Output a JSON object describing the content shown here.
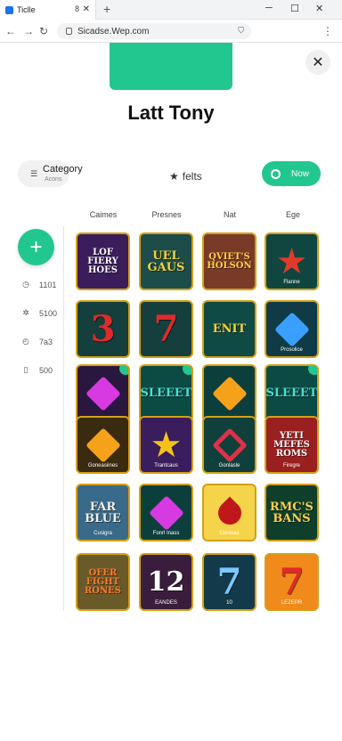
{
  "browser": {
    "tab_title": "Ticlle",
    "tab_mid": "8",
    "url": "Sicadse.Wep.com",
    "new_tab": "+"
  },
  "page": {
    "title": "Latt Tony",
    "close": "✕",
    "category": {
      "label": "Category",
      "sub": "Acons"
    },
    "star_label": "felts",
    "now_button": "Now",
    "columns": [
      "Caimes",
      "Presnes",
      "Nat",
      "Ege"
    ],
    "sidebar": [
      {
        "icon": "clock-icon",
        "label": "1101"
      },
      {
        "icon": "sparkle-icon",
        "label": "5100"
      },
      {
        "icon": "timer-icon",
        "label": "7a3"
      },
      {
        "icon": "phone-icon",
        "label": "500"
      }
    ]
  },
  "tiles": [
    {
      "text": "LOF FIERY HOES",
      "sub": "",
      "bg": "#3b1d5c",
      "fg": "#ffffff"
    },
    {
      "text": "UEL GAUS",
      "sub": "",
      "bg": "#1c4d4a",
      "fg": "#f5d13a"
    },
    {
      "text": "QVIET'S HOLSON",
      "sub": "",
      "bg": "#7a3a28",
      "fg": "#ffd04a"
    },
    {
      "text": "",
      "sub": "Flanne",
      "bg": "#10463f",
      "fg": "#e03a2a",
      "shape": "star"
    },
    {
      "text": "3",
      "sub": "",
      "bg": "#153f3c",
      "fg": "#e02a2a"
    },
    {
      "text": "7",
      "sub": "",
      "bg": "#153f3c",
      "fg": "#e02a2a"
    },
    {
      "text": "ENIT",
      "sub": "",
      "bg": "#0f4a44",
      "fg": "#f5d13a"
    },
    {
      "text": "",
      "sub": "Prosolice",
      "bg": "#103b46",
      "fg": "#3aa0ff",
      "shape": "gem"
    },
    {
      "text": "",
      "sub": "",
      "bg": "#2a1740",
      "fg": "#d63ae0",
      "shape": "gem",
      "dot": true
    },
    {
      "text": "SLEEET",
      "sub": "",
      "bg": "#0c4a44",
      "fg": "#45e0d0",
      "dot": true
    },
    {
      "text": "",
      "sub": "",
      "bg": "#0c3f3b",
      "fg": "#f5a21a",
      "shape": "gem"
    },
    {
      "text": "SLEEET",
      "sub": "",
      "bg": "#0c4a44",
      "fg": "#45e0d0",
      "dot": true
    },
    {
      "text": "",
      "sub": "Goneasiines",
      "bg": "#3a2a10",
      "fg": "#f5a21a",
      "shape": "gem"
    },
    {
      "text": "",
      "sub": "Trantcaus",
      "bg": "#3a1d5c",
      "fg": "#f5c21a",
      "shape": "star"
    },
    {
      "text": "",
      "sub": "Gonlasle",
      "bg": "#10403c",
      "fg": "#e0304a",
      "shape": "diamond"
    },
    {
      "text": "YETI MEFES ROMS",
      "sub": "Firegre",
      "bg": "#9a1f1f",
      "fg": "#ffffff"
    },
    {
      "text": "FAR BLUE",
      "sub": "Cusigra",
      "bg": "#3a6a8a",
      "fg": "#f0f0f0"
    },
    {
      "text": "",
      "sub": "Fonrl Inass",
      "bg": "#0c3f3b",
      "fg": "#d63ae0",
      "shape": "gem"
    },
    {
      "text": "",
      "sub": "Conloas",
      "bg": "#f5d34a",
      "fg": "#c0181a",
      "shape": "drop"
    },
    {
      "text": "RMC'S BANS",
      "sub": "",
      "bg": "#0f3f2a",
      "fg": "#ffd04a"
    },
    {
      "text": "OFER FIGHT RONES",
      "sub": "",
      "bg": "#6a5a2a",
      "fg": "#ff7a2a"
    },
    {
      "text": "12",
      "sub": "EANDES",
      "bg": "#3a1d3c",
      "fg": "#ffffff"
    },
    {
      "text": "7",
      "sub": "10",
      "bg": "#123a4a",
      "fg": "#7ac8ff"
    },
    {
      "text": "7",
      "sub": "LEZEPR",
      "bg": "#f08a1a",
      "fg": "#e02a2a"
    }
  ]
}
